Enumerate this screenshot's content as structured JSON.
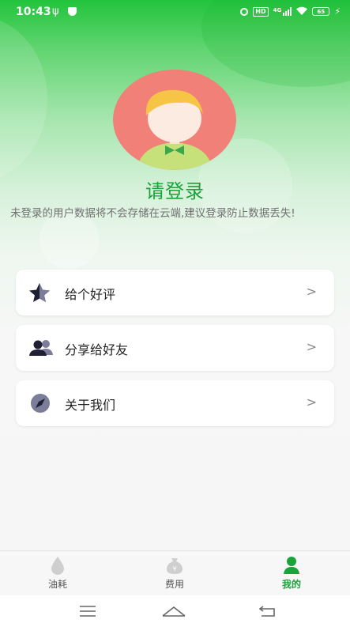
{
  "status_bar": {
    "time": "10:43",
    "network_badge": "HD",
    "signal_label": "4G",
    "battery": "65"
  },
  "profile": {
    "title": "请登录",
    "notice": "未登录的用户数据将不会存储在云端,建议登录防止数据丢失!"
  },
  "menu": [
    {
      "label": "给个好评",
      "icon": "star-icon"
    },
    {
      "label": "分享给好友",
      "icon": "users-icon"
    },
    {
      "label": "关于我们",
      "icon": "compass-icon"
    }
  ],
  "chevron": ">",
  "tabs": [
    {
      "label": "油耗",
      "icon": "drop-icon",
      "active": false
    },
    {
      "label": "费用",
      "icon": "money-bag-icon",
      "active": false
    },
    {
      "label": "我的",
      "icon": "person-icon",
      "active": true
    }
  ],
  "colors": {
    "brand_green": "#19a33a",
    "header_green": "#22c43c",
    "avatar_bg": "#f08078"
  }
}
